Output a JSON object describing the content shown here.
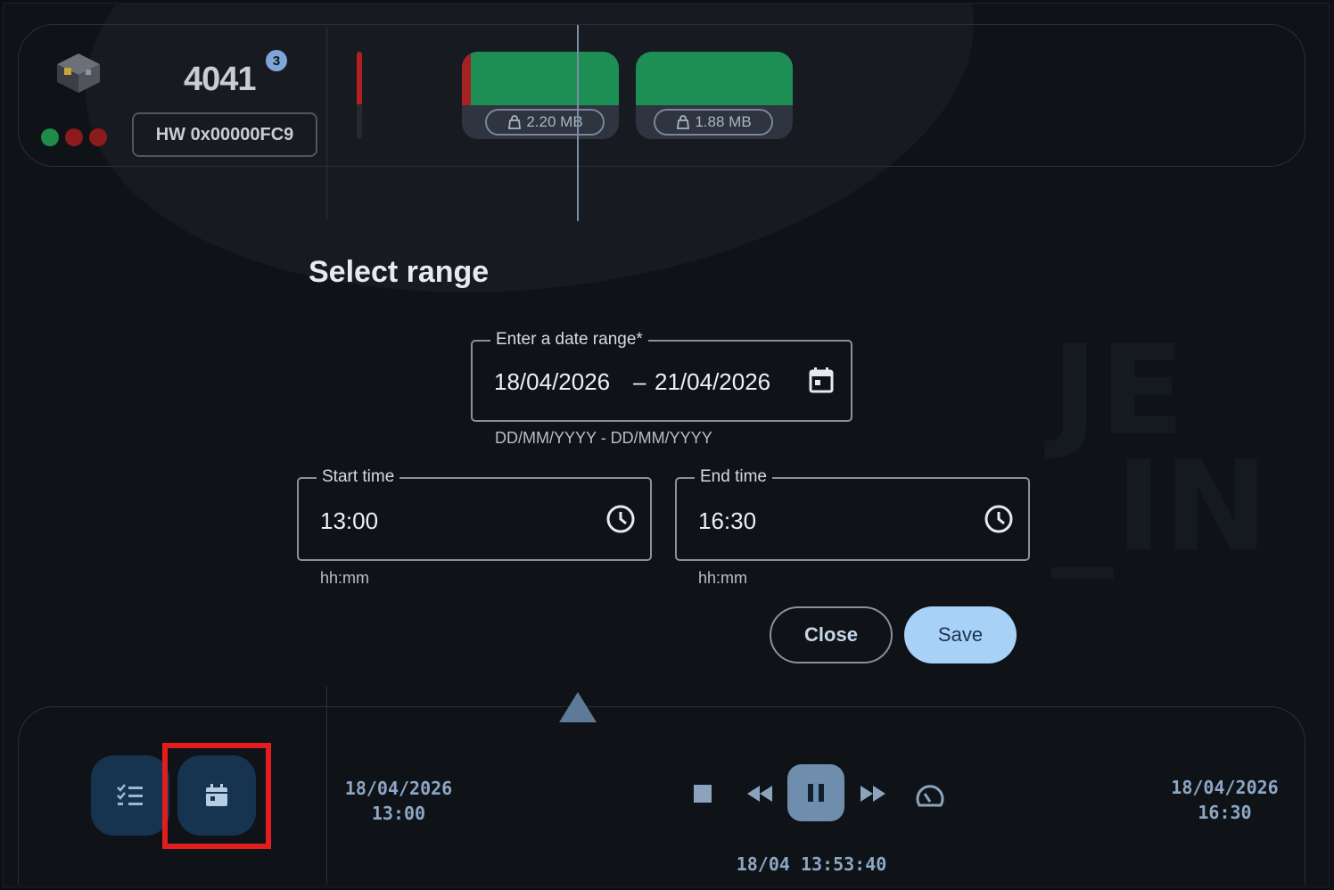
{
  "device": {
    "number": "4041",
    "badge": "3",
    "hardware_id": "HW 0x00000FC9",
    "status_dots": [
      "#1f8a4a",
      "#8d1b1b",
      "#8d1b1b"
    ],
    "level_fraction": 0.6
  },
  "storage_cards": [
    {
      "size": "2.20 MB",
      "has_error": true
    },
    {
      "size": "1.88 MB",
      "has_error": false
    }
  ],
  "dialog": {
    "title": "Select range",
    "date_range": {
      "label": "Enter a date range*",
      "start": "18/04/2026",
      "separator": "–",
      "end": "21/04/2026",
      "hint": "DD/MM/YYYY - DD/MM/YYYY"
    },
    "start_time": {
      "label": "Start time",
      "value": "13:00",
      "hint": "hh:mm"
    },
    "end_time": {
      "label": "End time",
      "value": "16:30",
      "hint": "hh:mm"
    },
    "close_label": "Close",
    "save_label": "Save"
  },
  "timeline": {
    "start_date": "18/04/2026",
    "start_time": "13:00",
    "end_date": "18/04/2026",
    "end_time": "16:30",
    "current": "18/04 13:53:40"
  },
  "icons": [
    "device-icon",
    "calendar-icon",
    "clock-icon",
    "list-icon",
    "stop-icon",
    "rewind-icon",
    "pause-icon",
    "fast-forward-icon",
    "speed-icon",
    "bag-icon"
  ],
  "colors": {
    "accent": "#a8d1f7",
    "green": "#1d8f55",
    "red": "#a62121",
    "highlight": "#e11d1d",
    "button_blue": "#163450"
  }
}
